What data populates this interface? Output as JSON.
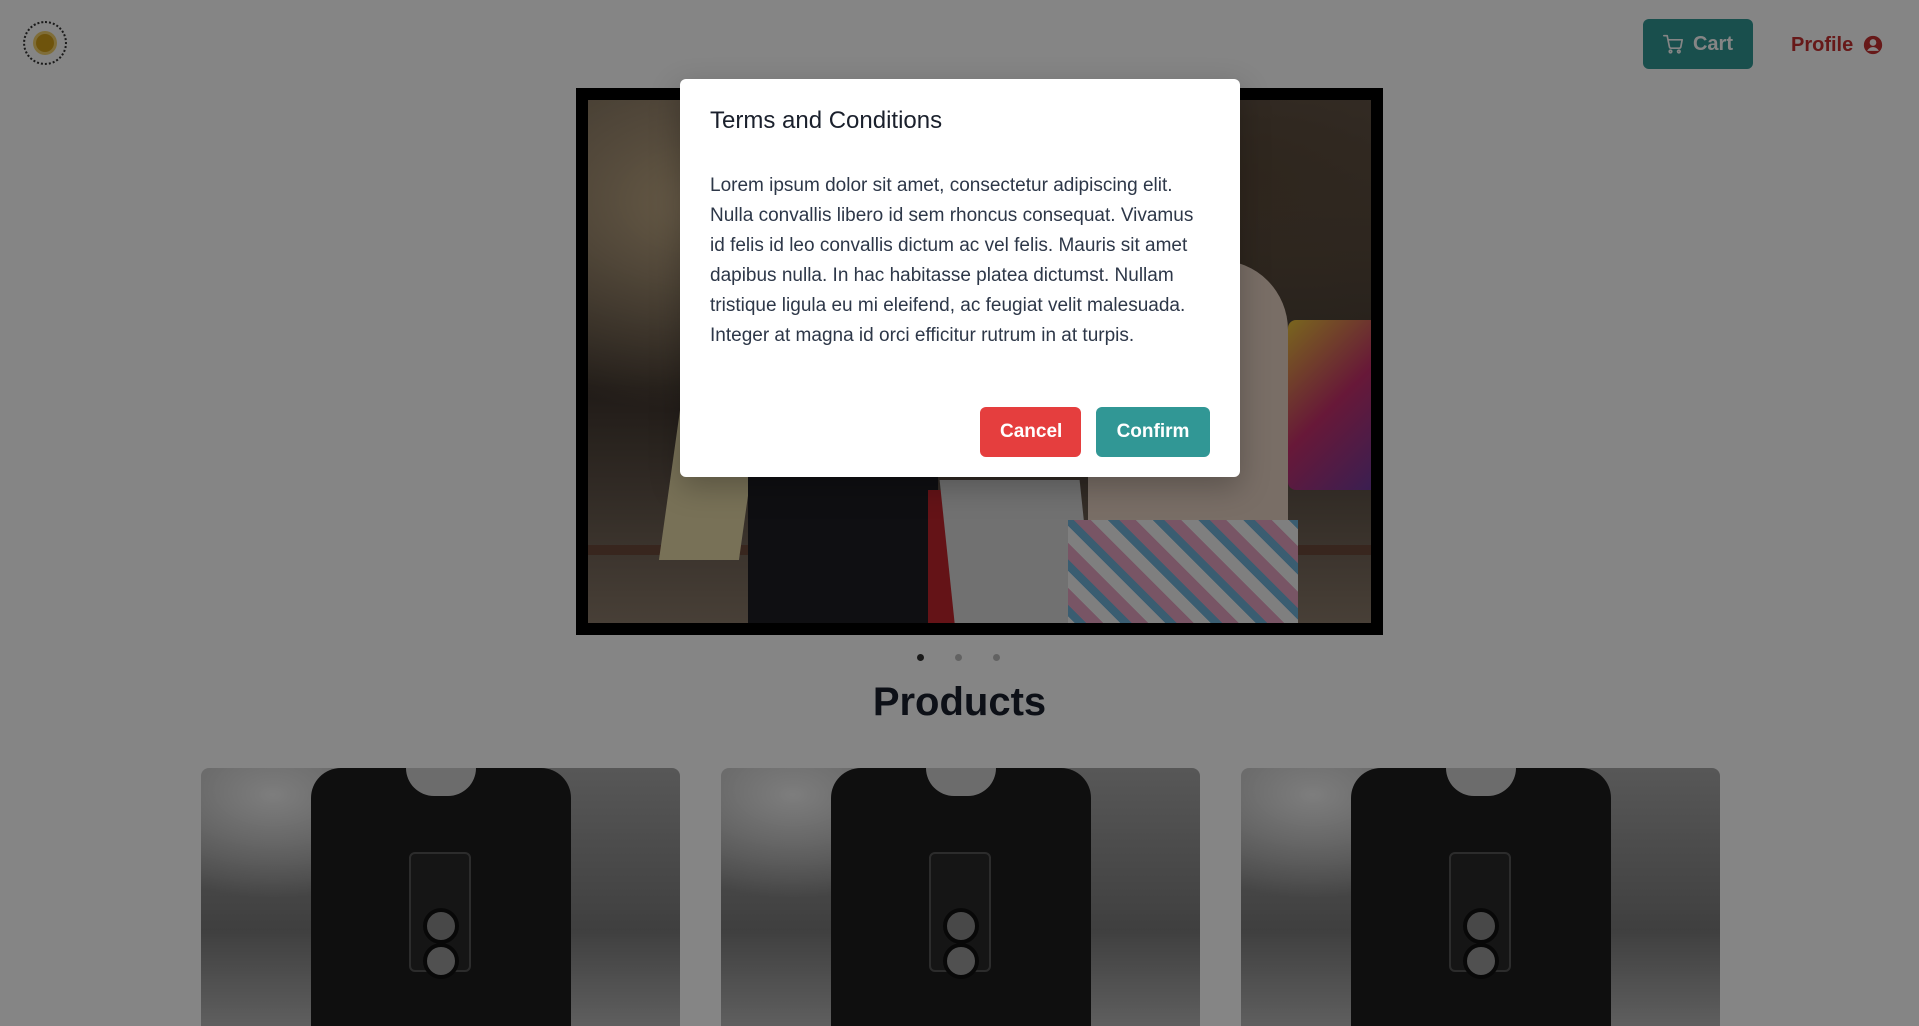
{
  "header": {
    "logo_name": "logo",
    "cart_label": "Cart",
    "profile_label": "Profile"
  },
  "carousel": {
    "slide_count": 3,
    "active_index": 0
  },
  "products": {
    "title": "Products",
    "items": [
      {
        "image": "camera-man-photo"
      },
      {
        "image": "camera-man-photo"
      },
      {
        "image": "camera-man-photo"
      }
    ]
  },
  "modal": {
    "title": "Terms and Conditions",
    "body": "Lorem ipsum dolor sit amet, consectetur adipiscing elit. Nulla convallis libero id sem rhoncus consequat. Vivamus id felis id leo convallis dictum ac vel felis. Mauris sit amet dapibus nulla. In hac habitasse platea dictumst. Nullam tristique ligula eu mi eleifend, ac feugiat velit malesuada. Integer at magna id orci efficitur rutrum in at turpis.",
    "cancel_label": "Cancel",
    "confirm_label": "Confirm"
  },
  "colors": {
    "accent_teal": "#319795",
    "danger_red": "#e53e3e",
    "profile_red": "#c53030"
  }
}
